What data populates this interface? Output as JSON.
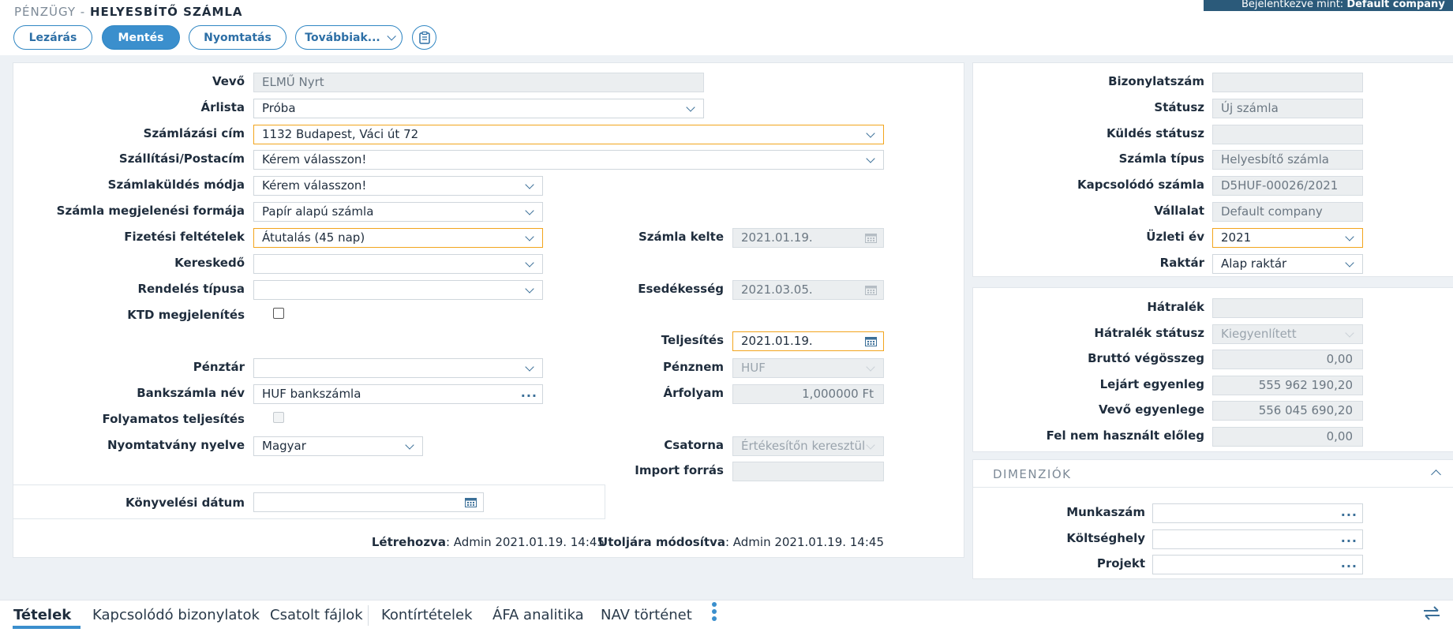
{
  "header": {
    "module": "PÉNZÜGY - ",
    "page_title": "HELYESBÍTŐ SZÁMLA",
    "login_label": "Bejelentkezve mint: ",
    "login_company": "Default company"
  },
  "toolbar": {
    "close_label": "Lezárás",
    "save_label": "Mentés",
    "print_label": "Nyomtatás",
    "more_label": "Továbbiak..."
  },
  "form": {
    "customer": {
      "label": "Vevő",
      "value": "ELMŰ Nyrt"
    },
    "pricelist": {
      "label": "Árlista",
      "value": "Próba"
    },
    "billing_address": {
      "label": "Számlázási cím",
      "value": "1132 Budapest, Váci út 72"
    },
    "shipping_address": {
      "label": "Szállítási/Postacím",
      "value": "Kérem válasszon!"
    },
    "send_mode": {
      "label": "Számlaküldés módja",
      "value": "Kérem válasszon!"
    },
    "invoice_format": {
      "label": "Számla megjelenési formája",
      "value": "Papír alapú számla"
    },
    "payment_terms": {
      "label": "Fizetési feltételek",
      "value": "Átutalás (45 nap)"
    },
    "merchant": {
      "label": "Kereskedő",
      "value": ""
    },
    "order_type": {
      "label": "Rendelés típusa",
      "value": ""
    },
    "ktd_display": {
      "label": "KTD megjelenítés"
    },
    "cash_register": {
      "label": "Pénztár",
      "value": ""
    },
    "bank_account": {
      "label": "Bankszámla név",
      "value": "HUF bankszámla"
    },
    "continuous": {
      "label": "Folyamatos teljesítés"
    },
    "print_language": {
      "label": "Nyomtatvány nyelve",
      "value": "Magyar"
    },
    "invoice_date": {
      "label": "Számla kelte",
      "value": "2021.01.19."
    },
    "due_date": {
      "label": "Esedékesség",
      "value": "2021.03.05."
    },
    "fulfillment": {
      "label": "Teljesítés",
      "value": "2021.01.19."
    },
    "currency": {
      "label": "Pénznem",
      "value": "HUF"
    },
    "exchange_rate": {
      "label": "Árfolyam",
      "value": "1,000000 Ft"
    },
    "channel": {
      "label": "Csatorna",
      "value": "Értékesítőn keresztül"
    },
    "import_source": {
      "label": "Import forrás",
      "value": ""
    },
    "posting_date": {
      "label": "Könyvelési dátum",
      "value": ""
    },
    "created": {
      "label": "Létrehozva",
      "value": ": Admin 2021.01.19. 14:45"
    },
    "modified": {
      "label": "Utoljára módosítva",
      "value": ": Admin 2021.01.19. 14:45"
    }
  },
  "doc_info": {
    "doc_number": {
      "label": "Bizonylatszám",
      "value": ""
    },
    "status": {
      "label": "Státusz",
      "value": "Új számla"
    },
    "send_status": {
      "label": "Küldés státusz",
      "value": ""
    },
    "invoice_type": {
      "label": "Számla típus",
      "value": "Helyesbítő számla"
    },
    "related_invoice": {
      "label": "Kapcsolódó számla",
      "value": "D5HUF-00026/2021"
    },
    "company": {
      "label": "Vállalat",
      "value": "Default company"
    },
    "fiscal_year": {
      "label": "Üzleti év",
      "value": "2021"
    },
    "warehouse": {
      "label": "Raktár",
      "value": "Alap raktár"
    }
  },
  "balance": {
    "arrears": {
      "label": "Hátralék",
      "value": ""
    },
    "arrears_status": {
      "label": "Hátralék státusz",
      "value": "Kiegyenlített"
    },
    "gross_total": {
      "label": "Bruttó végösszeg",
      "value": "0,00"
    },
    "overdue_balance": {
      "label": "Lejárt egyenleg",
      "value": "555 962 190,20"
    },
    "customer_balance": {
      "label": "Vevő egyenlege",
      "value": "556 045 690,20"
    },
    "unused_advance": {
      "label": "Fel nem használt előleg",
      "value": "0,00"
    }
  },
  "dimensions": {
    "title": "DIMENZIÓK",
    "job_number": {
      "label": "Munkaszám",
      "value": ""
    },
    "cost_center": {
      "label": "Költséghely",
      "value": ""
    },
    "project": {
      "label": "Projekt",
      "value": ""
    }
  },
  "tabs": [
    {
      "label": "Tételek"
    },
    {
      "label": "Kapcsolódó bizonylatok"
    },
    {
      "label": "Csatolt fájlok"
    },
    {
      "label": "Kontírtételek"
    },
    {
      "label": "ÁFA analitika"
    },
    {
      "label": "NAV történet"
    }
  ],
  "icons": {
    "dropdown": "chevron-down-icon",
    "calendar": "calendar-icon",
    "more": "ellipsis-icon",
    "clipboard": "clipboard-icon",
    "kebab": "kebab-menu-icon",
    "swap": "swap-arrows-icon"
  },
  "colors": {
    "accent": "#3b8fcd",
    "highlight_border": "#f2a51d",
    "banner": "#2b5a7a"
  }
}
